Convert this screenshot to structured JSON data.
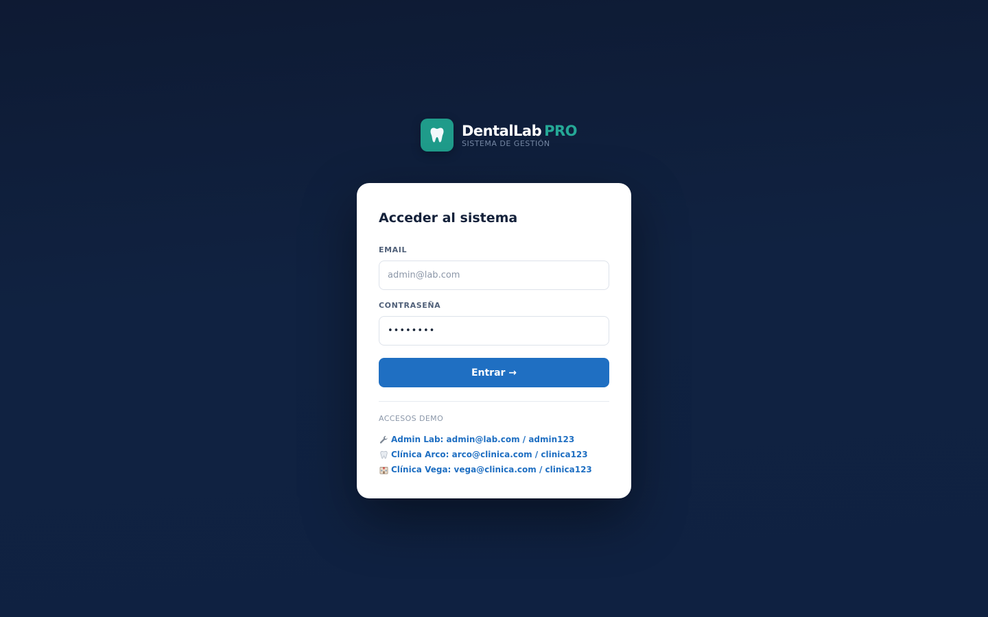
{
  "brand": {
    "name": "DentalLab",
    "suffix": "PRO",
    "tagline": "SISTEMA DE GESTIÓN",
    "logo_icon": "tooth-icon",
    "logo_color": "#1f9b8a",
    "accent_color": "#25a896"
  },
  "login": {
    "title": "Acceder al sistema",
    "email_label": "EMAIL",
    "email_placeholder": "admin@lab.com",
    "password_label": "CONTRASEÑA",
    "password_value": "••••••••",
    "submit_label": "Entrar →",
    "button_color": "#1f6fc2"
  },
  "demo": {
    "title": "ACCESOS DEMO",
    "items": [
      {
        "icon": "wrench-icon",
        "label": "Admin Lab: admin@lab.com / admin123"
      },
      {
        "icon": "tooth-icon",
        "label": "Clínica Arco: arco@clinica.com / clinica123"
      },
      {
        "icon": "hospital-icon",
        "label": "Clínica Vega: vega@clinica.com / clinica123"
      }
    ]
  }
}
